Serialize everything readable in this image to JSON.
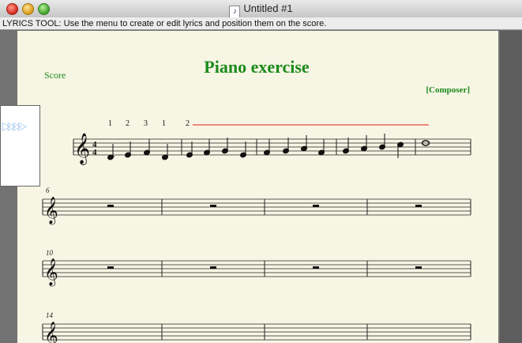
{
  "window": {
    "title": "Untitled #1",
    "controls": [
      "close",
      "minimize",
      "zoom"
    ],
    "doc_icon": "score-document-icon"
  },
  "hint_bar": {
    "text": "LYRICS TOOL: Use the menu to create or edit lyrics and position them on the score."
  },
  "score": {
    "label": "Score",
    "title": "Piano exercise",
    "composer": "[Composer]",
    "accent_color": "#1b8a1b",
    "fingerings": [
      "1",
      "2",
      "3",
      "1",
      "2"
    ],
    "time_signature": {
      "top": "4",
      "bottom": "4"
    },
    "systems": [
      {
        "measure_number": ""
      },
      {
        "measure_number": "6"
      },
      {
        "measure_number": "10"
      },
      {
        "measure_number": "14"
      }
    ]
  },
  "playback_panel": {
    "icon": "play-arrows-icon",
    "arrows": "▷▷▷▷"
  }
}
